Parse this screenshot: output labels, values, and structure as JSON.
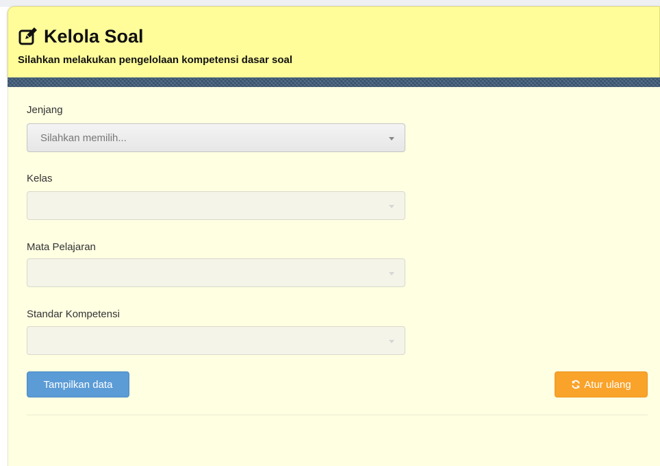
{
  "header": {
    "title_icon": "edit-icon",
    "title": "Kelola Soal",
    "subtitle": "Silahkan melakukan pengelolaan kompetensi dasar soal"
  },
  "form": {
    "jenjang": {
      "label": "Jenjang",
      "value": "Silahkan memilih..."
    },
    "kelas": {
      "label": "Kelas",
      "value": ""
    },
    "mata_pelajaran": {
      "label": "Mata Pelajaran",
      "value": ""
    },
    "standar_kompetensi": {
      "label": "Standar Kompetensi",
      "value": ""
    }
  },
  "actions": {
    "show_label": "Tampilkan data",
    "reset_label": "Atur ulang",
    "reset_icon": "refresh-icon"
  },
  "colors": {
    "header_bg": "#fffd9a",
    "panel_bg": "#ffffe2",
    "primary": "#5b9bd6",
    "warning": "#f9a32b"
  }
}
